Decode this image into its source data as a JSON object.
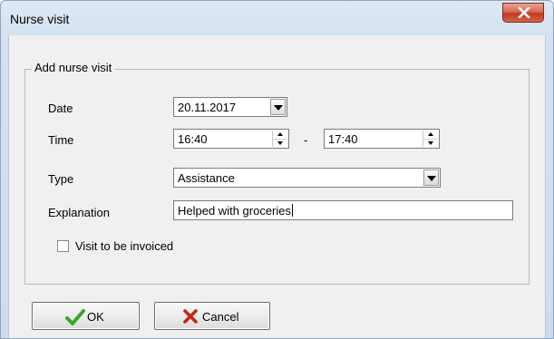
{
  "window": {
    "title": "Nurse visit"
  },
  "group": {
    "legend": "Add nurse visit",
    "date": {
      "label": "Date",
      "value": "20.11.2017"
    },
    "time": {
      "label": "Time",
      "from": "16:40",
      "separator": "-",
      "to": "17:40"
    },
    "type": {
      "label": "Type",
      "value": "Assistance"
    },
    "explanation": {
      "label": "Explanation",
      "value": "Helped with groceries"
    },
    "invoice": {
      "label": "Visit to be invoiced",
      "checked": false
    }
  },
  "buttons": {
    "ok": "OK",
    "cancel": "Cancel"
  },
  "colors": {
    "ok_check": "#3aa52a",
    "cancel_x": "#c8231a",
    "close_button": "#c7432a"
  }
}
